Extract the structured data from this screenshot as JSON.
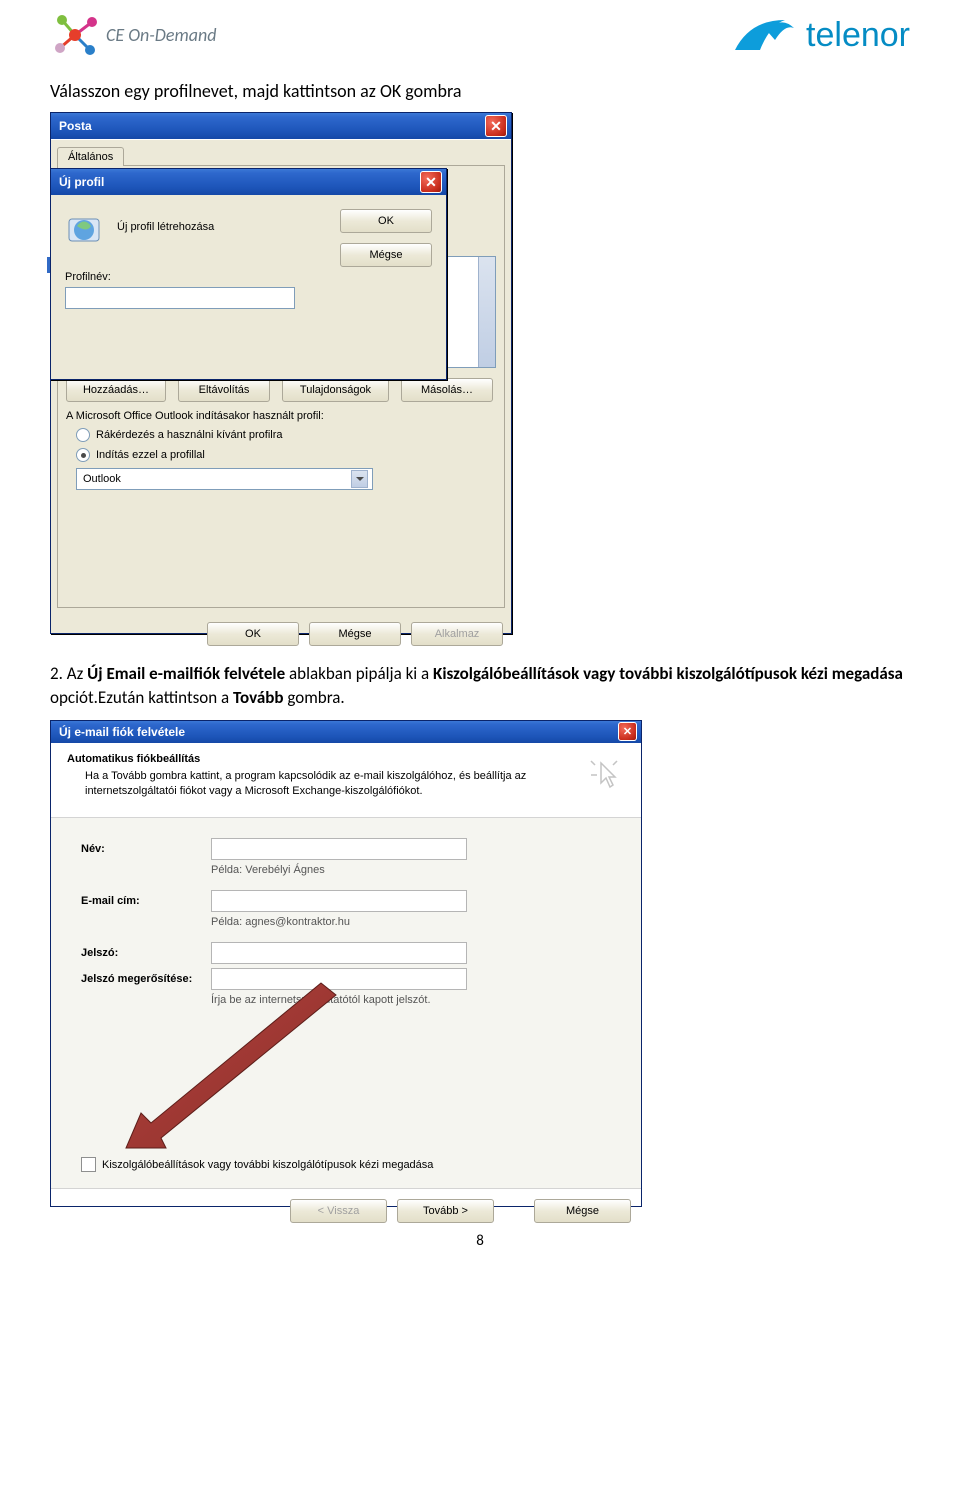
{
  "header": {
    "left_brand": "CE On-Demand",
    "right_brand": "telenor"
  },
  "instruction1": "Válasszon egy profilnevet, majd kattintson az OK gombra",
  "posta": {
    "title": "Posta",
    "tab": "Általános",
    "btn_add": "Hozzáadás…",
    "btn_remove": "Eltávolítás",
    "btn_props": "Tulajdonságok",
    "btn_copy": "Másolás…",
    "startup_label": "A Microsoft Office Outlook indításakor használt profil:",
    "radio_ask": "Rákérdezés a használni kívánt profilra",
    "radio_use": "Indítás ezzel a profillal",
    "profile_selected": "Outlook",
    "btn_ok": "OK",
    "btn_cancel": "Mégse",
    "btn_apply": "Alkalmaz"
  },
  "newprofile": {
    "title": "Új profil",
    "create_label": "Új profil létrehozása",
    "name_label": "Profilnév:",
    "btn_ok": "OK",
    "btn_cancel": "Mégse"
  },
  "instruction2_prefix": "2.  Az ",
  "instruction2_b1": "Új Email e-mailfiók felvétele",
  "instruction2_mid": " ablakban pipálja ki a ",
  "instruction2_b2": "Kiszolgálóbeállítások vagy további kiszolgálótípusok kézi megadása",
  "instruction2_mid2": " opciót.Ezután kattintson a ",
  "instruction2_b3": "Tovább",
  "instruction2_end": " gombra.",
  "wizard": {
    "title": "Új e-mail fiók felvétele",
    "heading": "Automatikus fiókbeállítás",
    "subheading": "Ha a Tovább gombra kattint, a program kapcsolódik az e-mail kiszolgálóhoz, és beállítja az internetszolgáltatói fiókot vagy a Microsoft Exchange-kiszolgálófiókot.",
    "label_name": "Név:",
    "hint_name": "Példa: Verebélyi Ágnes",
    "label_email": "E-mail cím:",
    "hint_email": "Példa: agnes@kontraktor.hu",
    "label_pw": "Jelszó:",
    "label_pw2": "Jelszó megerősítése:",
    "hint_pw": "Írja be az internetszolgáltatótól kapott jelszót.",
    "chk_manual": "Kiszolgálóbeállítások vagy további kiszolgálótípusok kézi megadása",
    "btn_back": "< Vissza",
    "btn_next": "Tovább >",
    "btn_cancel": "Mégse"
  },
  "page_number": "8"
}
